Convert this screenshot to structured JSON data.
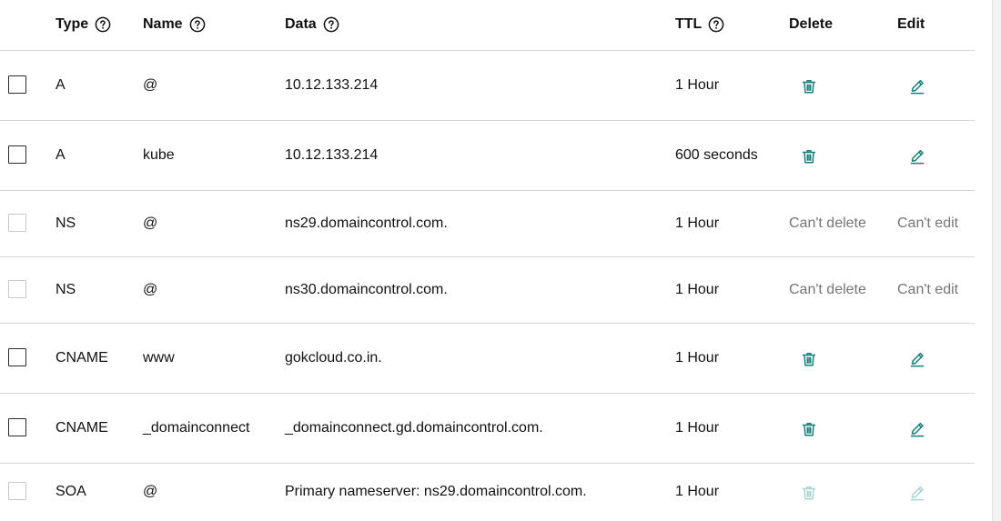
{
  "columns": {
    "type": "Type",
    "name": "Name",
    "data": "Data",
    "ttl": "TTL",
    "delete": "Delete",
    "edit": "Edit"
  },
  "icons": {
    "help": "help-circle-icon",
    "delete": "trash-icon",
    "edit": "pencil-icon"
  },
  "colors": {
    "icon_active": "#1a7f7a",
    "icon_disabled": "#a9d6d3",
    "muted_text": "#767676"
  },
  "records": [
    {
      "type": "A",
      "name": "@",
      "data": "10.12.133.214",
      "ttl": "1 Hour",
      "delete_state": "enabled",
      "edit_state": "enabled"
    },
    {
      "type": "A",
      "name": "kube",
      "data": "10.12.133.214",
      "ttl": "600 seconds",
      "delete_state": "enabled",
      "edit_state": "enabled"
    },
    {
      "type": "NS",
      "name": "@",
      "data": "ns29.domaincontrol.com.",
      "ttl": "1 Hour",
      "delete_state": "text",
      "delete_text": "Can't delete",
      "edit_state": "text",
      "edit_text": "Can't edit"
    },
    {
      "type": "NS",
      "name": "@",
      "data": "ns30.domaincontrol.com.",
      "ttl": "1 Hour",
      "delete_state": "text",
      "delete_text": "Can't delete",
      "edit_state": "text",
      "edit_text": "Can't edit"
    },
    {
      "type": "CNAME",
      "name": "www",
      "data": "gokcloud.co.in.",
      "ttl": "1 Hour",
      "delete_state": "enabled",
      "edit_state": "enabled"
    },
    {
      "type": "CNAME",
      "name": "_domainconnect",
      "data": "_domainconnect.gd.domaincontrol.com.",
      "ttl": "1 Hour",
      "delete_state": "enabled",
      "edit_state": "enabled"
    },
    {
      "type": "SOA",
      "name": "@",
      "data": "Primary nameserver: ns29.domaincontrol.com.",
      "ttl": "1 Hour",
      "delete_state": "disabled",
      "edit_state": "disabled"
    }
  ]
}
